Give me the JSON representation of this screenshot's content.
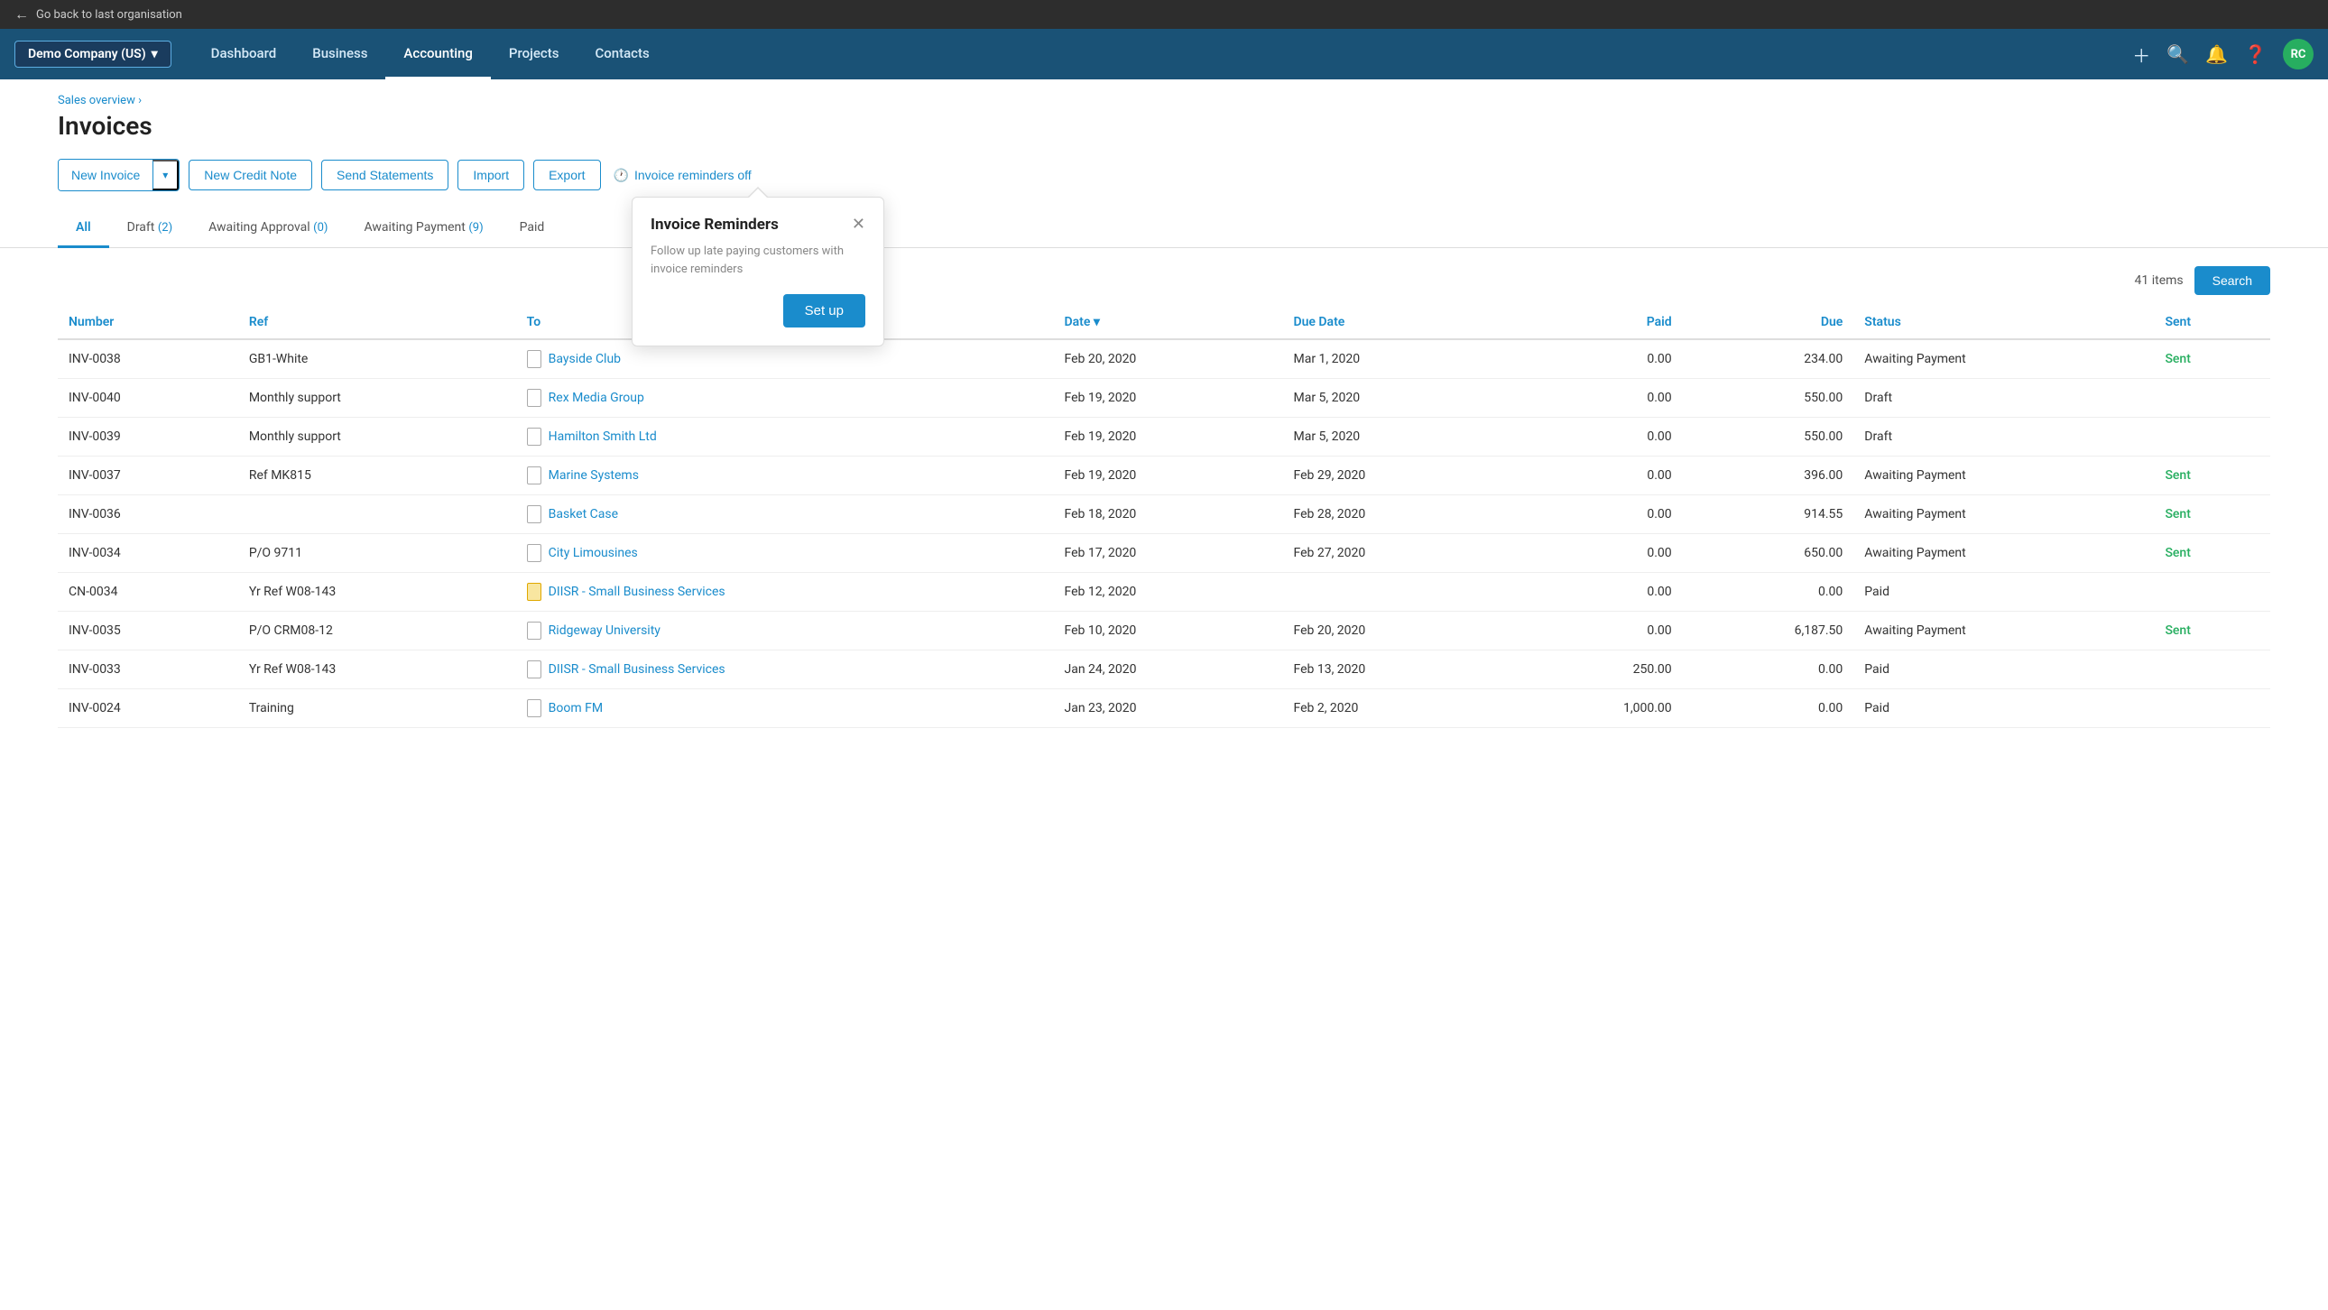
{
  "topbar": {
    "back_label": "Go back to last organisation"
  },
  "nav": {
    "company": "Demo Company (US)",
    "links": [
      {
        "id": "dashboard",
        "label": "Dashboard",
        "active": false
      },
      {
        "id": "business",
        "label": "Business",
        "active": false
      },
      {
        "id": "accounting",
        "label": "Accounting",
        "active": true
      },
      {
        "id": "projects",
        "label": "Projects",
        "active": false
      },
      {
        "id": "contacts",
        "label": "Contacts",
        "active": false
      }
    ],
    "avatar": "RC"
  },
  "breadcrumb": "Sales overview ›",
  "page_title": "Invoices",
  "toolbar": {
    "new_invoice": "New Invoice",
    "new_credit_note": "New Credit Note",
    "send_statements": "Send Statements",
    "import": "Import",
    "export": "Export",
    "invoice_reminders": "Invoice reminders off"
  },
  "tabs": [
    {
      "id": "all",
      "label": "All",
      "count": "",
      "active": true
    },
    {
      "id": "draft",
      "label": "Draft",
      "count": "2",
      "active": false
    },
    {
      "id": "awaiting-approval",
      "label": "Awaiting Approval",
      "count": "0",
      "active": false
    },
    {
      "id": "awaiting-payment",
      "label": "Awaiting Payment",
      "count": "9",
      "active": false
    },
    {
      "id": "paid",
      "label": "Paid",
      "count": "",
      "active": false
    }
  ],
  "table": {
    "items_count": "41 items",
    "search_label": "Search",
    "columns": [
      "Number",
      "Ref",
      "To",
      "Date",
      "Due Date",
      "Paid",
      "Due",
      "Status",
      "Sent"
    ],
    "rows": [
      {
        "number": "INV-0038",
        "ref": "GB1-White",
        "icon": "inv",
        "to": "Bayside Club",
        "date": "Feb 20, 2020",
        "due_date": "Mar 1, 2020",
        "paid": "0.00",
        "due": "234.00",
        "status": "Awaiting Payment",
        "sent": "Sent"
      },
      {
        "number": "INV-0040",
        "ref": "Monthly support",
        "icon": "inv",
        "to": "Rex Media Group",
        "date": "Feb 19, 2020",
        "due_date": "Mar 5, 2020",
        "paid": "0.00",
        "due": "550.00",
        "status": "Draft",
        "sent": ""
      },
      {
        "number": "INV-0039",
        "ref": "Monthly support",
        "icon": "inv",
        "to": "Hamilton Smith Ltd",
        "date": "Feb 19, 2020",
        "due_date": "Mar 5, 2020",
        "paid": "0.00",
        "due": "550.00",
        "status": "Draft",
        "sent": ""
      },
      {
        "number": "INV-0037",
        "ref": "Ref MK815",
        "icon": "inv",
        "to": "Marine Systems",
        "date": "Feb 19, 2020",
        "due_date": "Feb 29, 2020",
        "paid": "0.00",
        "due": "396.00",
        "status": "Awaiting Payment",
        "sent": "Sent"
      },
      {
        "number": "INV-0036",
        "ref": "",
        "icon": "inv",
        "to": "Basket Case",
        "date": "Feb 18, 2020",
        "due_date": "Feb 28, 2020",
        "paid": "0.00",
        "due": "914.55",
        "status": "Awaiting Payment",
        "sent": "Sent"
      },
      {
        "number": "INV-0034",
        "ref": "P/O 9711",
        "icon": "inv",
        "to": "City Limousines",
        "date": "Feb 17, 2020",
        "due_date": "Feb 27, 2020",
        "paid": "0.00",
        "due": "650.00",
        "status": "Awaiting Payment",
        "sent": "Sent"
      },
      {
        "number": "CN-0034",
        "ref": "Yr Ref W08-143",
        "icon": "credit",
        "to": "DIISR - Small Business Services",
        "date": "Feb 12, 2020",
        "due_date": "",
        "paid": "0.00",
        "due": "0.00",
        "status": "Paid",
        "sent": ""
      },
      {
        "number": "INV-0035",
        "ref": "P/O CRM08-12",
        "icon": "inv",
        "to": "Ridgeway University",
        "date": "Feb 10, 2020",
        "due_date": "Feb 20, 2020",
        "paid": "0.00",
        "due": "6,187.50",
        "status": "Awaiting Payment",
        "sent": "Sent"
      },
      {
        "number": "INV-0033",
        "ref": "Yr Ref W08-143",
        "icon": "inv",
        "to": "DIISR - Small Business Services",
        "date": "Jan 24, 2020",
        "due_date": "Feb 13, 2020",
        "paid": "250.00",
        "due": "0.00",
        "status": "Paid",
        "sent": ""
      },
      {
        "number": "INV-0024",
        "ref": "Training",
        "icon": "inv",
        "to": "Boom FM",
        "date": "Jan 23, 2020",
        "due_date": "Feb 2, 2020",
        "paid": "1,000.00",
        "due": "0.00",
        "status": "Paid",
        "sent": ""
      }
    ]
  },
  "popover": {
    "title": "Invoice Reminders",
    "description": "Follow up late paying customers with invoice reminders",
    "setup_label": "Set up"
  }
}
